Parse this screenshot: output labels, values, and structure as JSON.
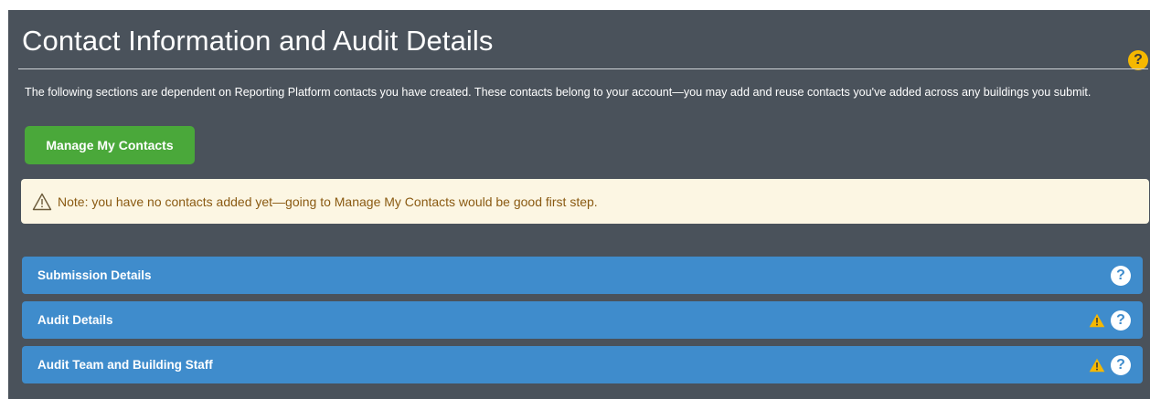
{
  "header": {
    "title": "Contact Information and Audit Details",
    "help_icon": "help-circle-icon",
    "help_glyph": "?"
  },
  "intro_text": "The following sections are dependent on Reporting Platform contacts you have created. These contacts belong to your account—you may add and reuse contacts you've added across any buildings you submit.",
  "manage_button": {
    "label": "Manage My Contacts"
  },
  "alert": {
    "icon": "warning-outline-icon",
    "text": "Note: you have no contacts added yet—going to Manage My Contacts would be good first step."
  },
  "sections": [
    {
      "label": "Submission Details",
      "warning": false,
      "help_glyph": "?"
    },
    {
      "label": "Audit Details",
      "warning": true,
      "help_glyph": "?"
    },
    {
      "label": "Audit Team and Building Staff",
      "warning": true,
      "help_glyph": "?"
    }
  ],
  "colors": {
    "panel_bg": "#4a525b",
    "primary_button": "#4aa83a",
    "section_bar": "#3f8ccc",
    "alert_bg": "#fcf6e3",
    "alert_text": "#8a5a12",
    "warning": "#f5b800"
  }
}
